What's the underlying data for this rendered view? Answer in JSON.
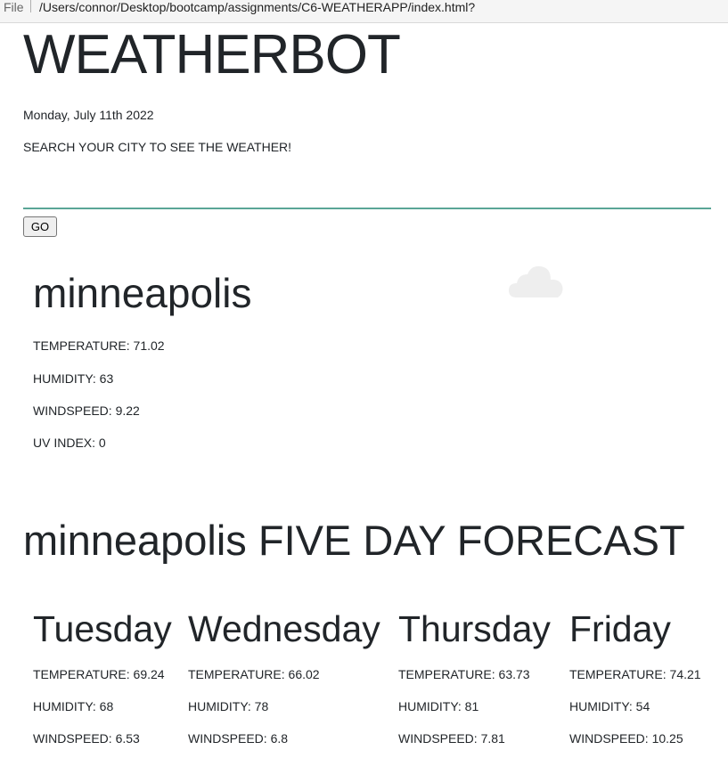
{
  "browser": {
    "file_label": "File",
    "url": "/Users/connor/Desktop/bootcamp/assignments/C6-WEATHERAPP/index.html?"
  },
  "app": {
    "title": "WEATHERBOT",
    "date": "Monday, July 11th 2022",
    "prompt": "SEARCH YOUR CITY TO SEE THE WEATHER!"
  },
  "search": {
    "value": "",
    "placeholder": "",
    "button_label": "GO"
  },
  "current": {
    "city": "minneapolis",
    "icon": "cloud-icon",
    "temperature": "TEMPERATURE: 71.02",
    "humidity": "HUMIDITY: 63",
    "windspeed": "WINDSPEED: 9.22",
    "uv_index": "UV INDEX: 0"
  },
  "forecast": {
    "title": "minneapolis FIVE DAY FORECAST",
    "days": [
      {
        "day": "Tuesday",
        "temperature": "TEMPERATURE: 69.24",
        "humidity": "HUMIDITY: 68",
        "windspeed": "WINDSPEED: 6.53"
      },
      {
        "day": "Wednesday",
        "temperature": "TEMPERATURE: 66.02",
        "humidity": "HUMIDITY: 78",
        "windspeed": "WINDSPEED: 6.8"
      },
      {
        "day": "Thursday",
        "temperature": "TEMPERATURE: 63.73",
        "humidity": "HUMIDITY: 81",
        "windspeed": "WINDSPEED: 7.81"
      },
      {
        "day": "Friday",
        "temperature": "TEMPERATURE: 74.21",
        "humidity": "HUMIDITY: 54",
        "windspeed": "WINDSPEED: 10.25"
      }
    ]
  },
  "colors": {
    "input_underline": "#5aa596",
    "text": "#212529",
    "cloud": "#eeeeee"
  }
}
